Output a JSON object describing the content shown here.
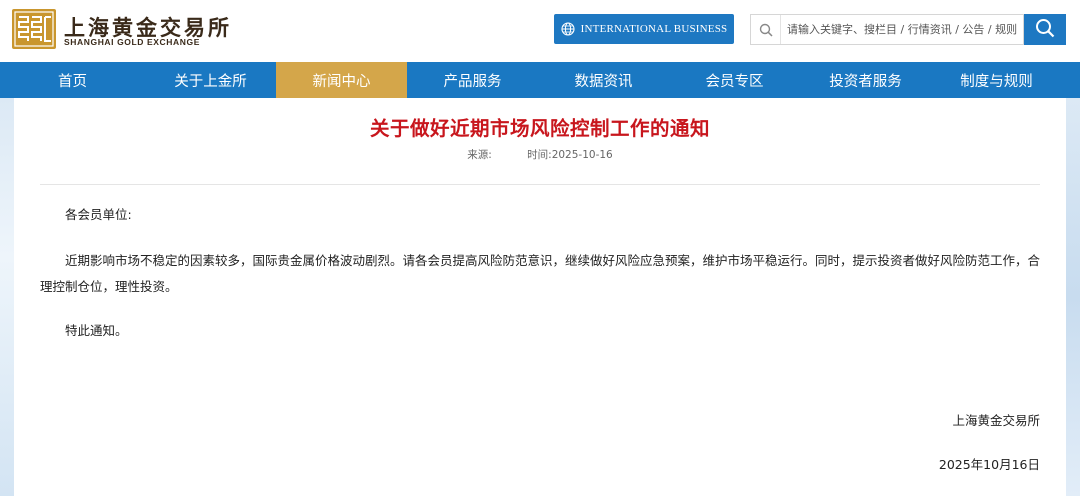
{
  "header": {
    "logo_cn": "上海黄金交易所",
    "logo_en": "SHANGHAI GOLD EXCHANGE",
    "intl_label": "INTERNATIONAL BUSINESS",
    "search_placeholder": "请输入关键字、搜栏目 / 行情资讯 / 公告 / 规则"
  },
  "nav": {
    "items": [
      {
        "label": "首页"
      },
      {
        "label": "关于上金所"
      },
      {
        "label": "新闻中心",
        "active": true
      },
      {
        "label": "产品服务"
      },
      {
        "label": "数据资讯"
      },
      {
        "label": "会员专区"
      },
      {
        "label": "投资者服务"
      },
      {
        "label": "制度与规则"
      }
    ]
  },
  "article": {
    "title": "关于做好近期市场风险控制工作的通知",
    "source_label": "来源:",
    "time_label": "时间:2025-10-16",
    "salutation": "各会员单位:",
    "paragraph": "近期影响市场不稳定的因素较多，国际贵金属价格波动剧烈。请各会员提高风险防范意识，继续做好风险应急预案，维护市场平稳运行。同时，提示投资者做好风险防范工作，合理控制仓位，理性投资。",
    "closing": "特此通知。",
    "signature_org": "上海黄金交易所",
    "signature_date": "2025年10月16日"
  },
  "colors": {
    "primary_blue": "#1a78c2",
    "active_gold": "#d4a64a",
    "title_red": "#c8161d",
    "logo_gold": "#c9962e"
  }
}
